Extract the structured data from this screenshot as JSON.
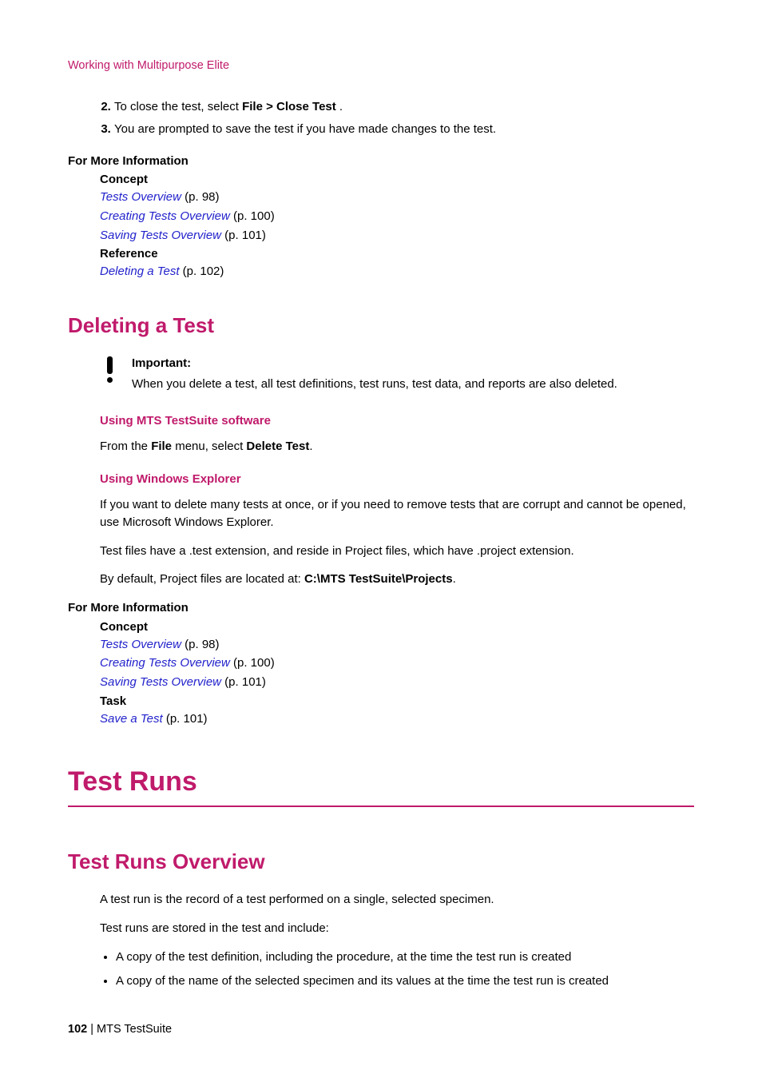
{
  "header": {
    "breadcrumb": "Working with Multipurpose Elite"
  },
  "steps": {
    "s2_pre": "To close the test, select ",
    "s2_bold": "File > Close Test",
    "s2_post": " .",
    "s3": "You are prompted to save the test if you have made changes to the test."
  },
  "fmi1": {
    "head": "For More Information",
    "concept": "Concept",
    "l1": "Tests Overview",
    "l1p": " (p. 98)",
    "l2": "Creating Tests Overview",
    "l2p": " (p. 100)",
    "l3": "Saving Tests Overview",
    "l3p": " (p. 101)",
    "ref": "Reference",
    "l4": "Deleting a Test",
    "l4p": " (p. 102)"
  },
  "delete": {
    "title": "Deleting a Test",
    "imp_label": "Important:",
    "imp_text": "When you delete a test, all test definitions, test runs, test data, and reports are also deleted.",
    "sub1": "Using MTS TestSuite software",
    "p1_pre": "From the ",
    "p1_b1": "File",
    "p1_mid": " menu, select ",
    "p1_b2": "Delete Test",
    "p1_post": ".",
    "sub2": "Using Windows Explorer",
    "p2": "If you want to delete many tests at once, or if you need to remove tests that are corrupt and cannot be opened, use Microsoft Windows Explorer.",
    "p3": "Test files have a .test extension, and reside in Project files, which have .project extension.",
    "p4_pre": "By default, Project files are located at: ",
    "p4_b": "C:\\MTS TestSuite\\Projects",
    "p4_post": "."
  },
  "fmi2": {
    "head": "For More Information",
    "concept": "Concept",
    "l1": "Tests Overview",
    "l1p": " (p. 98)",
    "l2": "Creating Tests Overview",
    "l2p": " (p. 100)",
    "l3": "Saving Tests Overview",
    "l3p": " (p. 101)",
    "task": "Task",
    "l4": "Save a Test",
    "l4p": " (p. 101)"
  },
  "runs": {
    "h1": "Test Runs",
    "h2": "Test Runs Overview",
    "p1": "A test run is the record of a test performed on a single, selected specimen.",
    "p2": "Test runs are stored in the test and include:",
    "b1": "A copy of the test definition, including the procedure, at the time the test run is created",
    "b2": "A copy of the name of the selected specimen and its values at the time the test run is created"
  },
  "footer": {
    "page": "102",
    "sep": " | ",
    "doc": "MTS TestSuite"
  }
}
